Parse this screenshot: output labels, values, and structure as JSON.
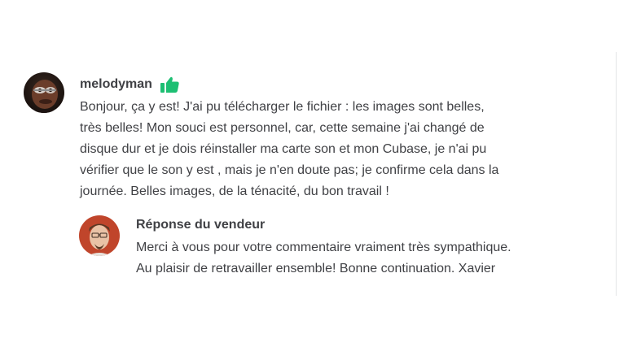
{
  "review": {
    "reviewer_name": "melodyman",
    "badge_icon": "thumbs-up-icon",
    "badge_color": "#1dbf73",
    "text_lines": [
      "Bonjour, ça y est! J'ai pu télécharger le fichier : les images sont belles,",
      "très belles! Mon souci est personnel, car, cette semaine j'ai changé de",
      "disque dur et je dois réinstaller ma carte son et mon Cubase, je n'ai pu",
      "vérifier que le son y est , mais je n'en doute pas; je confirme cela dans la",
      "journée. Belles images, de la ténacité, du bon travail !"
    ]
  },
  "reply": {
    "title": "Réponse du vendeur",
    "text_lines": [
      "Merci à vous pour votre commentaire vraiment très sympathique.",
      "Au plaisir de retravailler ensemble! Bonne continuation. Xavier"
    ]
  }
}
